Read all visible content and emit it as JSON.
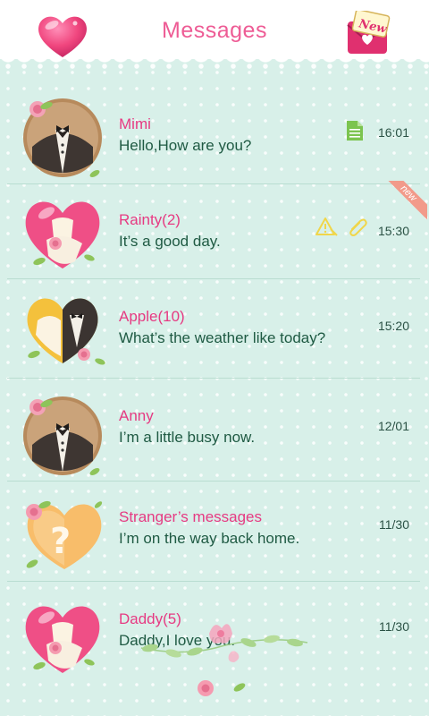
{
  "header": {
    "title": "Messages",
    "left_icon": "heart-icon",
    "right_icon": "new-message-icon",
    "right_icon_text": "New"
  },
  "conversations": [
    {
      "name": "Mimi",
      "message": "Hello,How are you?",
      "time": "16:01",
      "avatar": "tuxedo-avatar",
      "icons": [
        "document-icon"
      ]
    },
    {
      "name": "Rainty(2)",
      "message": "It’s a good day.",
      "time": "15:30",
      "avatar": "heart-couple-avatar",
      "icons": [
        "warning-icon",
        "paperclip-icon"
      ],
      "ribbon": "new"
    },
    {
      "name": "Apple(10)",
      "message": "What’s the weather like today?",
      "time": "15:20",
      "avatar": "couple-heart-avatar"
    },
    {
      "name": "Anny",
      "message": "I’m a little busy now.",
      "time": "12/01",
      "avatar": "tuxedo-avatar"
    },
    {
      "name": "Stranger’s messages",
      "message": "I’m on the way back home.",
      "time": "11/30",
      "avatar": "question-heart-avatar"
    },
    {
      "name": "Daddy(5)",
      "message": "Daddy,I love you.",
      "time": "11/30",
      "avatar": "heart-couple-avatar"
    }
  ],
  "colors": {
    "title": "#ee5c95",
    "name": "#e63a82",
    "message": "#1f5a43",
    "background": "#d8f0e9"
  }
}
